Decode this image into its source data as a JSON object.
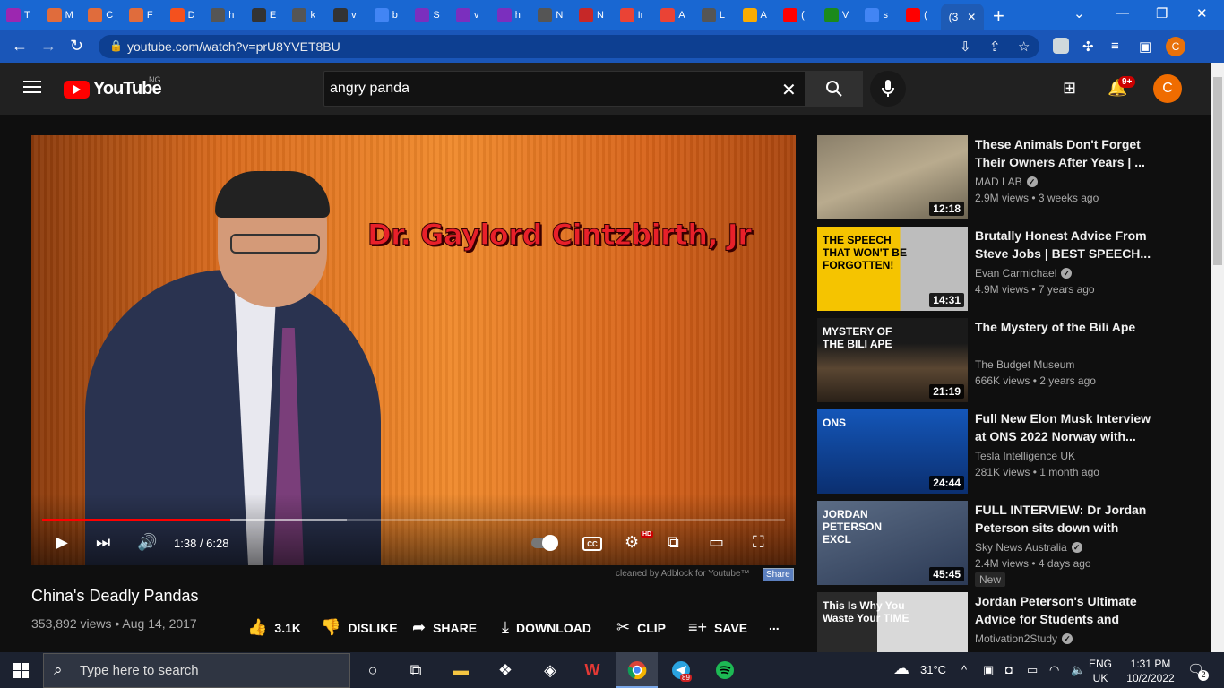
{
  "browser": {
    "tabs": [
      {
        "letter": "T",
        "color": "#9c27b0",
        "icon": "tab-icon"
      },
      {
        "letter": "M",
        "color": "#e06c3c",
        "icon": "tab-icon"
      },
      {
        "letter": "C",
        "color": "#e06c3c",
        "icon": "tab-icon"
      },
      {
        "letter": "F",
        "color": "#e06c3c",
        "icon": "tab-icon"
      },
      {
        "letter": "D",
        "color": "#f4511e",
        "icon": "tab-icon"
      },
      {
        "letter": "h",
        "color": "#555",
        "icon": "tab-icon"
      },
      {
        "letter": "E",
        "color": "#333",
        "icon": "tab-icon"
      },
      {
        "letter": "k",
        "color": "#555",
        "icon": "tab-icon"
      },
      {
        "letter": "v",
        "color": "#333",
        "icon": "tab-icon"
      },
      {
        "letter": "b",
        "color": "#4285f4",
        "icon": "tab-icon"
      },
      {
        "letter": "S",
        "color": "#7b2fbe",
        "icon": "tab-icon"
      },
      {
        "letter": "v",
        "color": "#7b2fbe",
        "icon": "tab-icon"
      },
      {
        "letter": "h",
        "color": "#7b2fbe",
        "icon": "tab-icon"
      },
      {
        "letter": "N",
        "color": "#555",
        "icon": "tab-icon"
      },
      {
        "letter": "N",
        "color": "#c62828",
        "icon": "tab-icon"
      },
      {
        "letter": "Ir",
        "color": "#ea4335",
        "icon": "tab-icon"
      },
      {
        "letter": "A",
        "color": "#ea4335",
        "icon": "tab-icon"
      },
      {
        "letter": "L",
        "color": "#555",
        "icon": "tab-icon"
      },
      {
        "letter": "A",
        "color": "#f9ab00",
        "icon": "tab-icon"
      },
      {
        "letter": "(",
        "color": "#ff0000",
        "icon": "tab-icon"
      },
      {
        "letter": "V",
        "color": "#1b8a1b",
        "icon": "tab-icon"
      },
      {
        "letter": "s",
        "color": "#4285f4",
        "icon": "tab-icon"
      },
      {
        "letter": "(",
        "color": "#ff0000",
        "icon": "tab-icon"
      }
    ],
    "active_tab_label": "(3",
    "close_glyph": "✕",
    "new_tab_glyph": "+",
    "url": "youtube.com/watch?v=prU8YVET8BU",
    "profile_initial": "C"
  },
  "youtube": {
    "logo_text": "YouTube",
    "country_code": "NG",
    "search_query": "angry panda",
    "notification_count": "9+",
    "avatar_initial": "C"
  },
  "player": {
    "overlay_name": "Dr. Gaylord Cintzbirth, Jr",
    "current_time": "1:38 / 6:28",
    "progress_fraction": 0.253,
    "buffer_fraction": 0.41,
    "cc_label": "CC",
    "hd_label": "HD",
    "adblock_note": "cleaned by Adblock for Youtube™",
    "share_chip": "Share"
  },
  "video": {
    "title": "China's Deadly Pandas",
    "meta": "353,892 views • Aug 14, 2017",
    "actions": {
      "like": "3.1K",
      "dislike": "DISLIKE",
      "share": "SHARE",
      "download": "DOWNLOAD",
      "clip": "CLIP",
      "save": "SAVE",
      "more": "..."
    }
  },
  "recommendations": [
    {
      "title": "These Animals Don't Forget Their Owners After Years | ...",
      "channel": "MAD LAB",
      "verified": true,
      "stats": "2.9M views • 3 weeks ago",
      "duration": "12:18",
      "thumb_bg": "linear-gradient(160deg,#8a7f6a,#b9ab8e 50%,#6b6351)",
      "thumb_text": "",
      "new": false
    },
    {
      "title": "Brutally Honest Advice From Steve Jobs | BEST SPEECH...",
      "channel": "Evan Carmichael",
      "verified": true,
      "stats": "4.9M views • 7 years ago",
      "duration": "14:31",
      "thumb_bg": "linear-gradient(90deg,#f5c400 55%,#bdbdbd 55%)",
      "thumb_text": "THE SPEECH THAT WON'T BE FORGOTTEN!",
      "new": false
    },
    {
      "title": "The Mystery of the Bili Ape",
      "channel": "The Budget Museum",
      "verified": false,
      "stats": "666K views • 2 years ago",
      "duration": "21:19",
      "thumb_bg": "linear-gradient(180deg,#1a1a1a 30%,#5a4632 60%,#2a2118)",
      "thumb_text": "MYSTERY OF THE BILI APE",
      "new": false
    },
    {
      "title": "Full New Elon Musk Interview at ONS 2022 Norway with...",
      "channel": "Tesla Intelligence UK",
      "verified": false,
      "stats": "281K views • 1 month ago",
      "duration": "24:44",
      "thumb_bg": "linear-gradient(180deg,#1456b8,#0b2f70)",
      "thumb_text": "ONS",
      "new": false
    },
    {
      "title": "FULL INTERVIEW: Dr Jordan Peterson sits down with Piers...",
      "channel": "Sky News Australia",
      "verified": true,
      "stats": "2.4M views • 4 days ago",
      "duration": "45:45",
      "thumb_bg": "linear-gradient(160deg,#5b6c85,#2c3a55)",
      "thumb_text": "JORDAN PETERSON EXCL",
      "new": true,
      "new_label": "New"
    },
    {
      "title": "Jordan Peterson's Ultimate Advice for Students and Colle...",
      "channel": "Motivation2Study",
      "verified": true,
      "stats": "",
      "duration": "",
      "thumb_bg": "linear-gradient(90deg,#2a2a2a 40%,#d9d9d9 40%)",
      "thumb_text": "This Is Why You Waste Your TIME",
      "new": false
    }
  ],
  "taskbar": {
    "search_placeholder": "Type here to search",
    "weather": "31°C",
    "language": "ENG",
    "region": "UK",
    "time": "1:31 PM",
    "date": "10/2/2022",
    "notification_count": "2",
    "telegram_badge": "89"
  }
}
